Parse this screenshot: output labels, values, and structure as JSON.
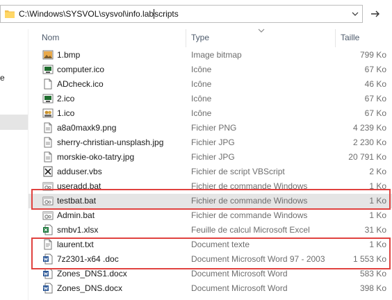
{
  "address": {
    "path_part1": "C:\\Windows\\SYSVOL\\sysvol\\info.lab",
    "path_part2": "scripts"
  },
  "nav": {
    "partial_label": "e"
  },
  "columns": {
    "name": "Nom",
    "type": "Type",
    "size": "Taille"
  },
  "files": [
    {
      "name": "1.bmp",
      "type": "Image bitmap",
      "size": "799 Ko",
      "icon": "bitmap-icon",
      "selected": false
    },
    {
      "name": "computer.ico",
      "type": "Icône",
      "size": "67 Ko",
      "icon": "computer-ico-icon",
      "selected": false
    },
    {
      "name": "ADcheck.ico",
      "type": "Icône",
      "size": "46 Ko",
      "icon": "blank-file-icon",
      "selected": false
    },
    {
      "name": "2.ico",
      "type": "Icône",
      "size": "67 Ko",
      "icon": "computer-ico-icon",
      "selected": false
    },
    {
      "name": "1.ico",
      "type": "Icône",
      "size": "67 Ko",
      "icon": "users-ico-icon",
      "selected": false
    },
    {
      "name": "a8a0maxk9.png",
      "type": "Fichier PNG",
      "size": "4 239 Ko",
      "icon": "image-file-icon",
      "selected": false
    },
    {
      "name": "sherry-christian-unsplash.jpg",
      "type": "Fichier JPG",
      "size": "2 230 Ko",
      "icon": "image-file-icon",
      "selected": false
    },
    {
      "name": "morskie-oko-tatry.jpg",
      "type": "Fichier JPG",
      "size": "20 791 Ko",
      "icon": "image-file-icon",
      "selected": false
    },
    {
      "name": "adduser.vbs",
      "type": "Fichier de script VBScript",
      "size": "2 Ko",
      "icon": "vbscript-icon",
      "selected": false
    },
    {
      "name": "useradd.bat",
      "type": "Fichier de commande Windows",
      "size": "1 Ko",
      "icon": "batch-file-icon",
      "selected": false
    },
    {
      "name": "testbat.bat",
      "type": "Fichier de commande Windows",
      "size": "1 Ko",
      "icon": "batch-file-icon",
      "selected": true
    },
    {
      "name": "Admin.bat",
      "type": "Fichier de commande Windows",
      "size": "1 Ko",
      "icon": "batch-file-icon",
      "selected": false
    },
    {
      "name": "smbv1.xlsx",
      "type": "Feuille de calcul Microsoft Excel",
      "size": "31 Ko",
      "icon": "excel-file-icon",
      "selected": false
    },
    {
      "name": "laurent.txt",
      "type": "Document texte",
      "size": "1 Ko",
      "icon": "text-file-icon",
      "selected": false
    },
    {
      "name": "7z2301-x64 .doc",
      "type": "Document Microsoft Word 97 - 2003",
      "size": "1 553 Ko",
      "icon": "word-file-icon",
      "selected": false
    },
    {
      "name": "Zones_DNS1.docx",
      "type": "Document Microsoft Word",
      "size": "583 Ko",
      "icon": "word-file-icon",
      "selected": false
    },
    {
      "name": "Zones_DNS.docx",
      "type": "Document Microsoft Word",
      "size": "398 Ko",
      "icon": "word-file-icon",
      "selected": false
    }
  ],
  "colors": {
    "highlight_border": "#e0423f",
    "selected_row": "#e5e5e5",
    "header_text": "#4d5a6b"
  }
}
